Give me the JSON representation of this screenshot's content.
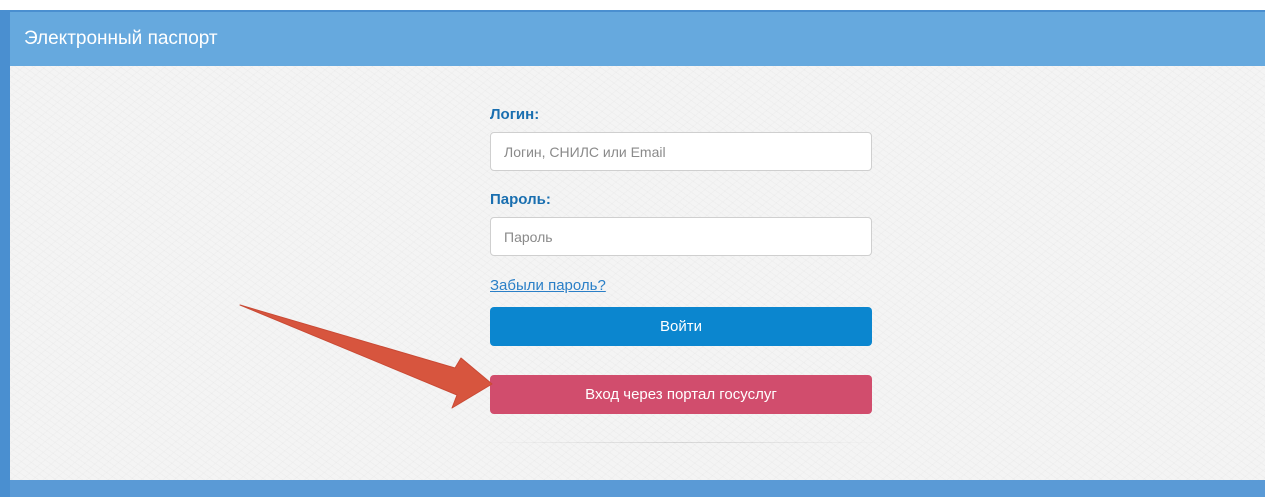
{
  "header": {
    "title": "Электронный паспорт"
  },
  "form": {
    "login_label": "Логин:",
    "login_placeholder": "Логин, СНИЛС или Email",
    "password_label": "Пароль:",
    "password_placeholder": "Пароль",
    "forgot_link": "Забыли пароль?",
    "login_button": "Войти",
    "gosuslugi_button": "Вход через портал госуслуг"
  },
  "icons": {
    "annotation": "arrow-icon"
  },
  "colors": {
    "header": "#66a9de",
    "frame_border": "#4a8fd0",
    "label": "#1a6fb0",
    "link": "#2a7fc7",
    "login_button": "#0b86cf",
    "gosuslugi_button": "#d14d6d",
    "arrow": "#d7553e"
  }
}
